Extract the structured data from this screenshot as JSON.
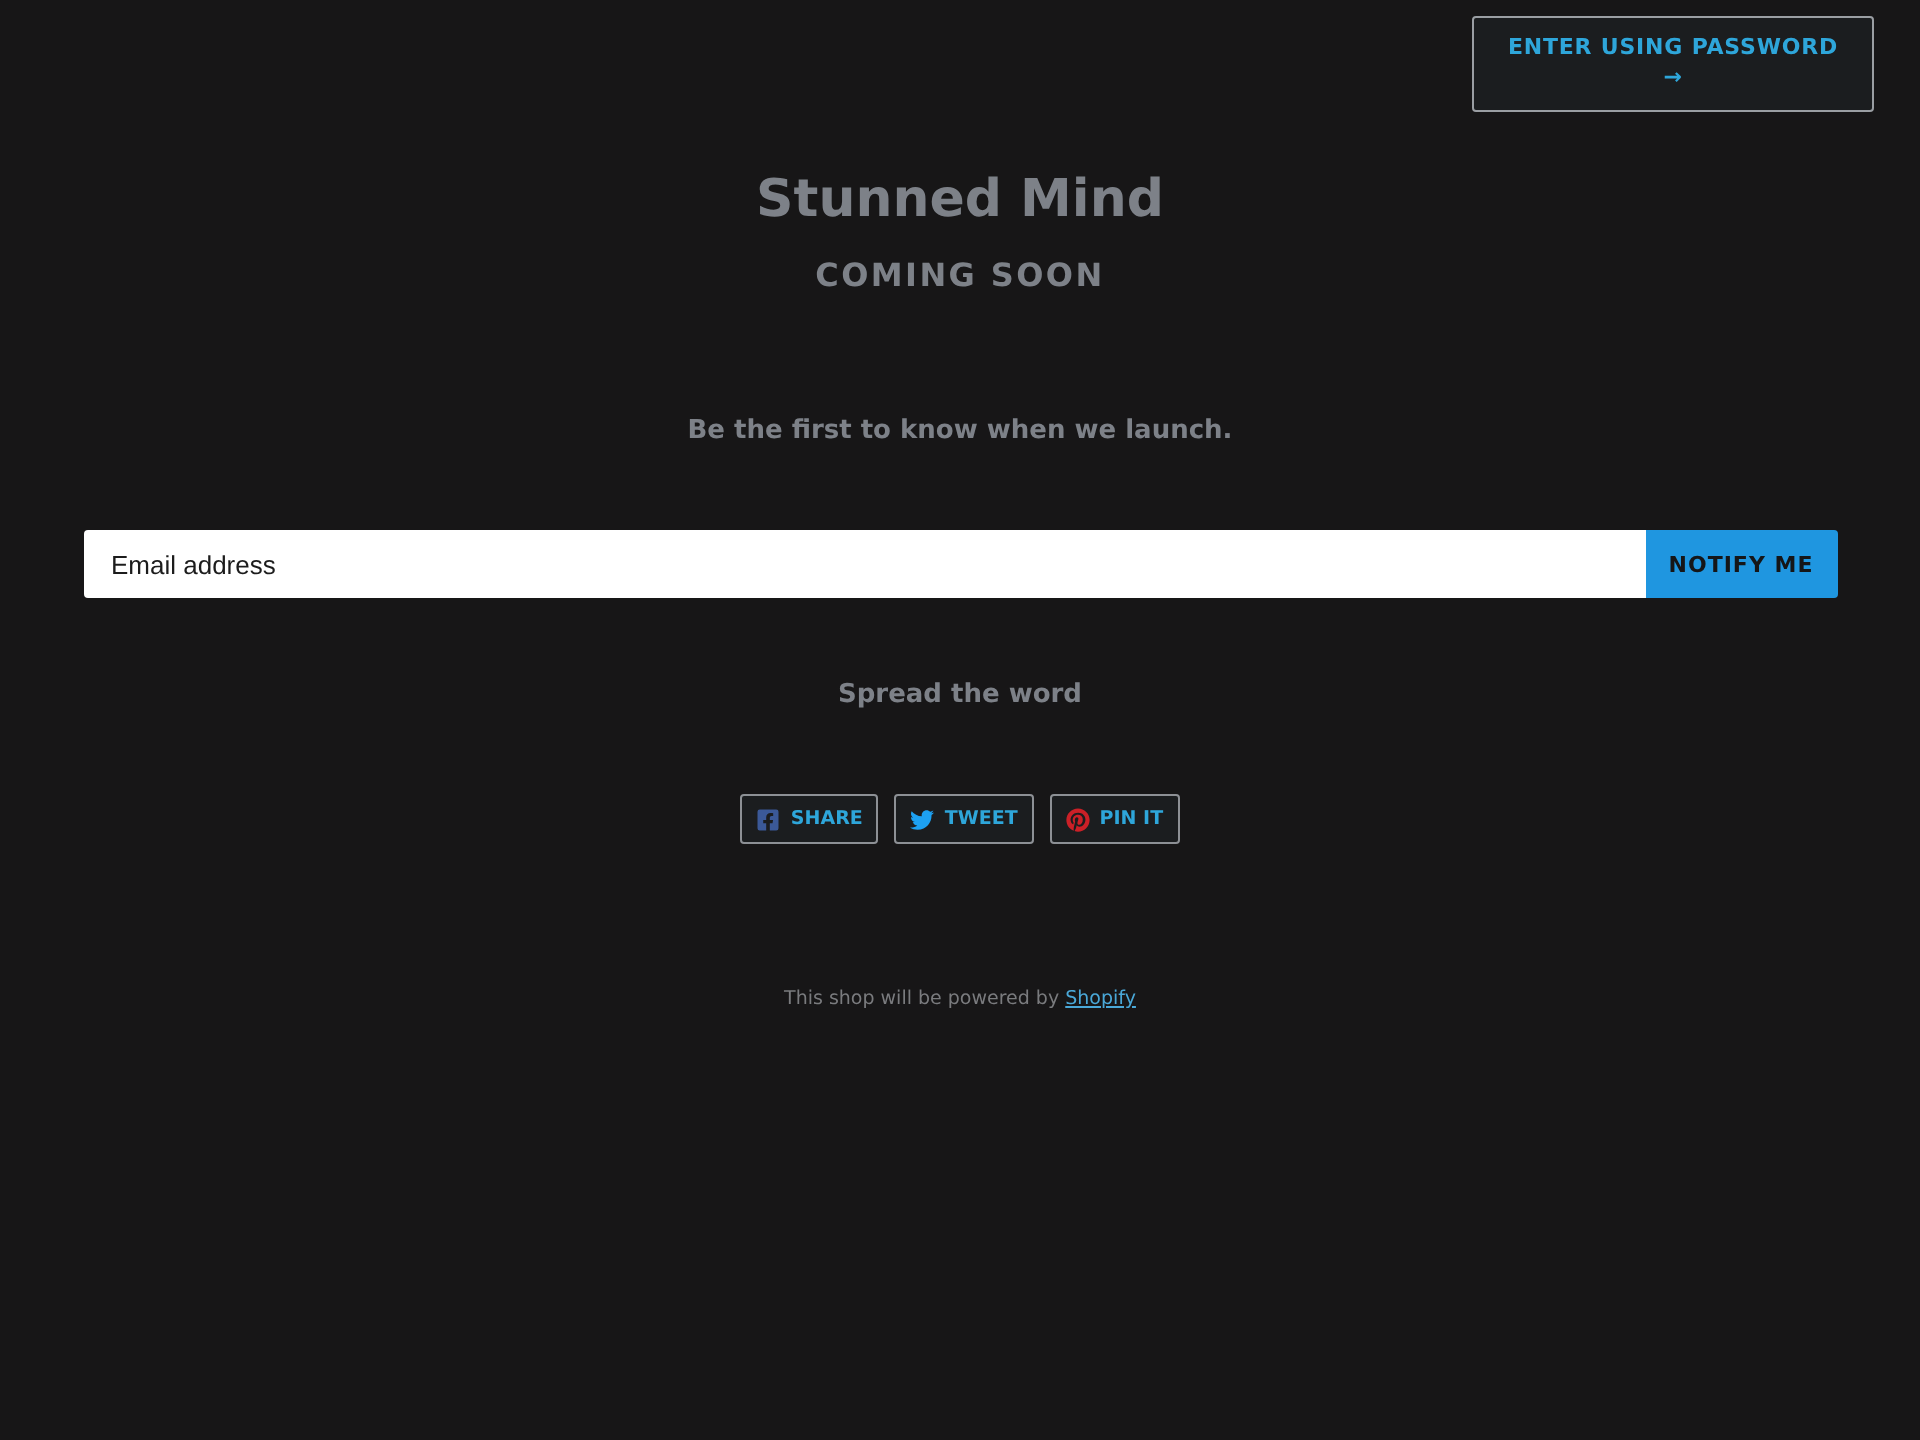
{
  "password_button": {
    "label": "ENTER USING PASSWORD",
    "arrow": "→"
  },
  "header": {
    "title": "Stunned Mind",
    "subtitle": "COMING SOON"
  },
  "signup": {
    "text": "Be the first to know when we launch.",
    "email_field": {
      "placeholder": "Email address"
    },
    "button": "NOTIFY ME"
  },
  "share": {
    "heading": "Spread the word",
    "buttons": [
      {
        "kind": "facebook",
        "label": "SHARE"
      },
      {
        "kind": "twitter",
        "label": "TWEET"
      },
      {
        "kind": "pinterest",
        "label": "PIN IT"
      }
    ]
  },
  "footer": {
    "text": "This shop will be powered by",
    "link": "Shopify"
  }
}
